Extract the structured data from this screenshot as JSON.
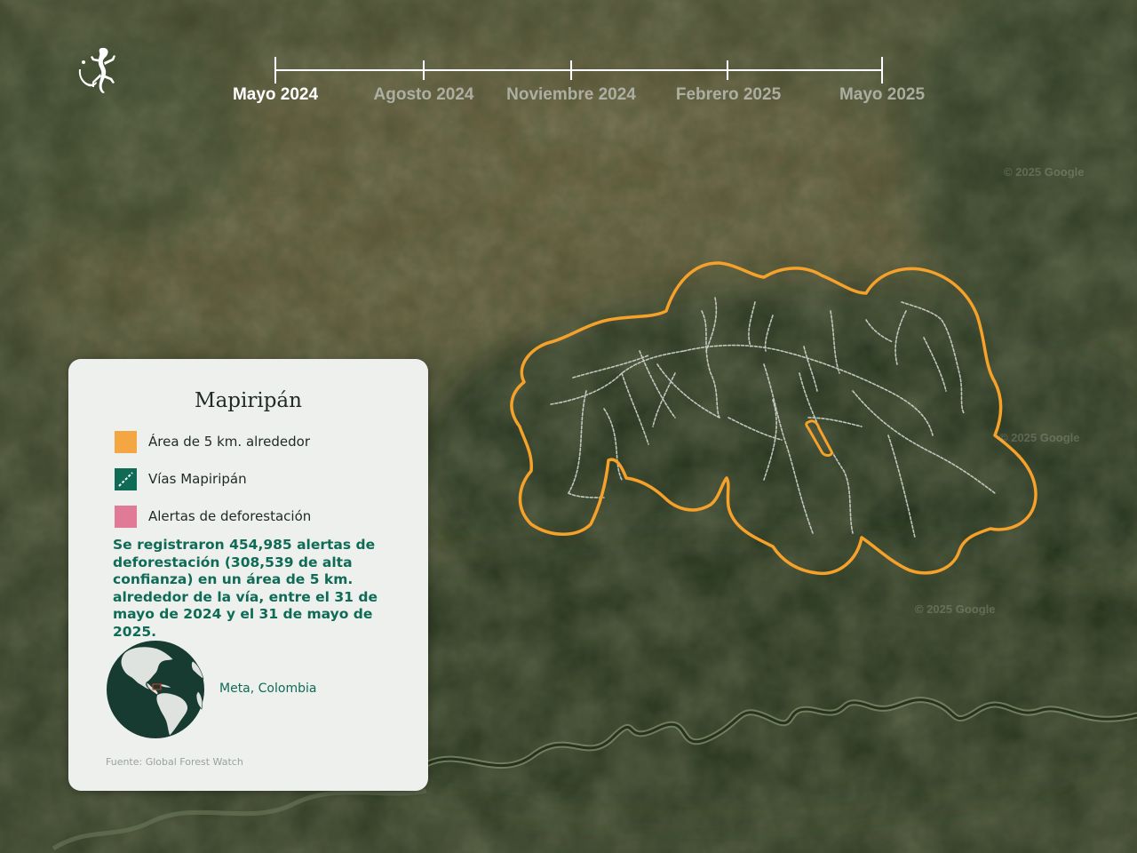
{
  "timeline": {
    "items": [
      {
        "label": "Mayo 2024",
        "active": true
      },
      {
        "label": "Agosto 2024",
        "active": false
      },
      {
        "label": "Noviembre 2024",
        "active": false
      },
      {
        "label": "Febrero 2025",
        "active": false
      },
      {
        "label": "Mayo 2025",
        "active": false
      }
    ]
  },
  "map": {
    "watermarks": [
      "© 2025 Google",
      "© 2025 Google",
      "© 2025 Google"
    ],
    "colors": {
      "buffer_outline": "#f5a12a",
      "roads": "#d8dcd8",
      "forest": "#1e2e16",
      "river": "#8a9a76"
    }
  },
  "logo": {
    "icon": "gecko-icon"
  },
  "legend": {
    "title": "Mapiripán",
    "items": [
      {
        "label": "Área de 5 km. alrededor",
        "color": "#f3a642",
        "icon": "orange-square-icon"
      },
      {
        "label": "Vías Mapiripán",
        "color": "#0f6b55",
        "icon": "dashed-road-icon"
      },
      {
        "label": "Alertas de deforestación",
        "color": "#e07a96",
        "icon": "pink-square-icon"
      }
    ],
    "description": "Se registraron 454,985 alertas de deforestación (308,539 de alta confianza) en un área de 5 km. alrededor de la vía, entre el 31 de mayo de 2024 y el 31 de mayo de 2025.",
    "location": "Meta, Colombia",
    "globe_icon": "globe-americas-icon",
    "source": "Fuente: Global Forest Watch"
  }
}
